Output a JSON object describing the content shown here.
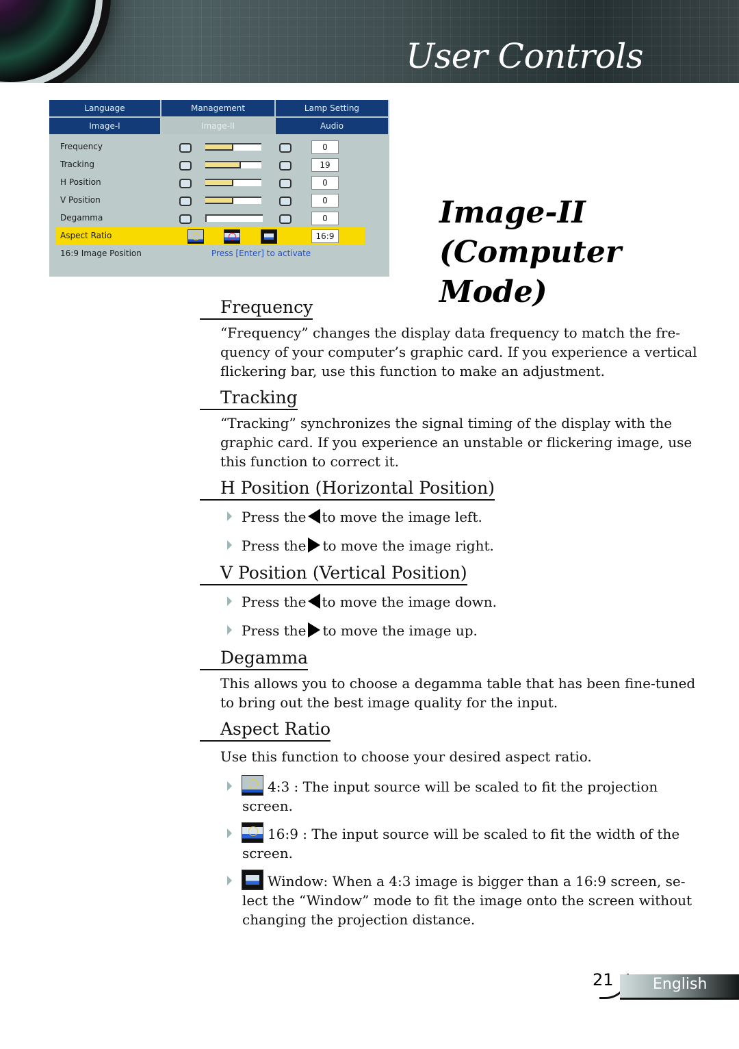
{
  "header": {
    "title": "User Controls"
  },
  "osd": {
    "tabs_row1": [
      "Language",
      "Management",
      "Lamp Setting"
    ],
    "tabs_row2": [
      "Image-I",
      "Image-II",
      "Audio"
    ],
    "active_tab": "Image-II",
    "rows": [
      {
        "label": "Frequency",
        "value": "0",
        "level": 0.5
      },
      {
        "label": "Tracking",
        "value": "19",
        "level": 0.63
      },
      {
        "label": "H Position",
        "value": "0",
        "level": 0.5
      },
      {
        "label": "V Position",
        "value": "0",
        "level": 0.5
      },
      {
        "label": "Degamma",
        "value": "0",
        "level": 0.0
      }
    ],
    "aspect_ratio": {
      "label": "Aspect Ratio",
      "value": "16:9",
      "icons": [
        "aspect-4-3-icon",
        "aspect-16-9-icon",
        "aspect-window-icon"
      ]
    },
    "image_position": {
      "label": "16:9 Image Position",
      "action": "Press [Enter] to activate"
    },
    "colors": {
      "tab_bg": "#123b77",
      "panel_bg": "#bccaca",
      "highlight": "#f8d900",
      "bar_fill": "#f3df88",
      "link": "#1d4ed8"
    }
  },
  "section": {
    "title": "Image-II",
    "subtitle": "(Computer Mode)"
  },
  "content": {
    "frequency": {
      "heading": "Frequency",
      "text": "“Frequency” changes the display data frequency to match the fre- quency of your computer’s graphic card. If you experience a vertical flickering bar, use this function to make an adjustment."
    },
    "tracking": {
      "heading": "Tracking",
      "text": "“Tracking” synchronizes the signal timing of the display with the graphic card. If you experience an unstable or flickering image, use this function to correct it."
    },
    "hpos": {
      "heading": "H Position (Horizontal Position)",
      "bullets": [
        {
          "pre": "Press the",
          "key": "left-arrow-icon",
          "post": "to move the image left."
        },
        {
          "pre": "Press the",
          "key": "right-arrow-icon",
          "post": "to move the image right."
        }
      ]
    },
    "vpos": {
      "heading": "V Position (Vertical Position)",
      "bullets": [
        {
          "pre": "Press the",
          "key": "left-arrow-icon",
          "post": "to move the image down."
        },
        {
          "pre": "Press the",
          "key": "right-arrow-icon",
          "post": "to move the image up."
        }
      ]
    },
    "degamma": {
      "heading": "Degamma",
      "text": "This allows you to choose a degamma table that has been fine-tuned to bring out the best image quality for the input."
    },
    "aspect": {
      "heading": "Aspect Ratio",
      "text": "Use this function to choose your desired aspect ratio.",
      "bullets": [
        {
          "icon": "aspect-4-3-icon",
          "line1": "4:3 : The input source will be scaled to fit the projection",
          "line2": "screen."
        },
        {
          "icon": "aspect-16-9-icon",
          "line1": "16:9 : The input source will be scaled to fit the width of the",
          "line2": "screen."
        },
        {
          "icon": "aspect-window-icon",
          "line1": "Window: When a 4:3 image is bigger than a 16:9 screen, se-",
          "line2": "lect the “Window” mode to fit the image onto the screen without changing the projection distance."
        }
      ]
    }
  },
  "footer": {
    "page_number": "21",
    "language": "English"
  }
}
